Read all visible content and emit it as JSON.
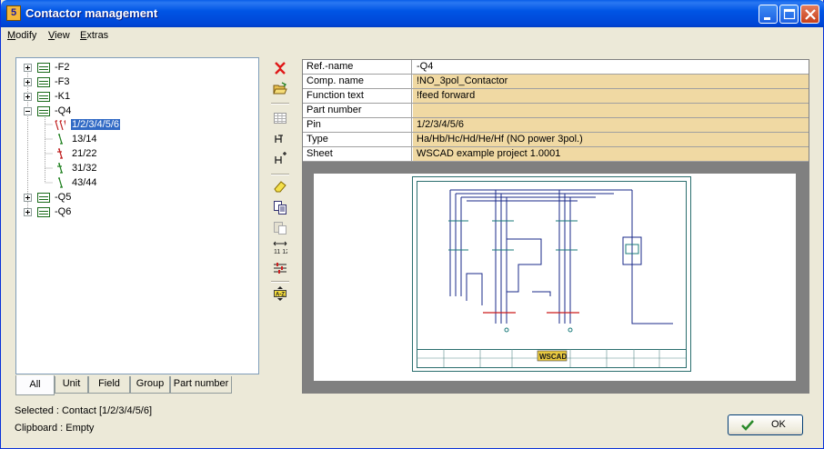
{
  "window": {
    "title": "Contactor management",
    "app_icon_text": "5"
  },
  "menu": [
    {
      "label": "Modify",
      "hotkey_index": 0
    },
    {
      "label": "View",
      "hotkey_index": 0
    },
    {
      "label": "Extras",
      "hotkey_index": 0
    }
  ],
  "tree": {
    "nodes": [
      {
        "label": "-F2",
        "expanded": false
      },
      {
        "label": "-F3",
        "expanded": false
      },
      {
        "label": "-K1",
        "expanded": false
      },
      {
        "label": "-Q4",
        "expanded": true,
        "children": [
          {
            "label": "1/2/3/4/5/6",
            "selected": true
          },
          {
            "label": "13/14"
          },
          {
            "label": "21/22"
          },
          {
            "label": "31/32"
          },
          {
            "label": "43/44"
          }
        ]
      },
      {
        "label": "-Q5",
        "expanded": false
      },
      {
        "label": "-Q6",
        "expanded": false
      }
    ]
  },
  "tabs": [
    "All",
    "Unit",
    "Field",
    "Group",
    "Part number"
  ],
  "active_tab": "All",
  "toolbar_icons": [
    "delete-icon",
    "open-folder-icon",
    "table-icon",
    "contact-icon",
    "contact-plus-icon",
    "eraser-icon",
    "copy-icon",
    "paste-icon",
    "numbering-icon",
    "settings-icon",
    "rename-icon"
  ],
  "properties": [
    {
      "name": "Ref.-name",
      "value": "-Q4"
    },
    {
      "name": "Comp. name",
      "value": "!NO_3pol_Contactor"
    },
    {
      "name": "Function text",
      "value": "!feed forward"
    },
    {
      "name": "Part number",
      "value": ""
    },
    {
      "name": "Pin",
      "value": "1/2/3/4/5/6"
    },
    {
      "name": "Type",
      "value": "Ha/Hb/Hc/Hd/He/Hf (NO power 3pol.)"
    },
    {
      "name": "Sheet",
      "value": "WSCAD example project 1.0001"
    }
  ],
  "preview": {
    "logo_text": "WSCAD"
  },
  "status": {
    "selected": "Selected : Contact [1/2/3/4/5/6]",
    "clipboard": "Clipboard : Empty"
  },
  "ok_button": {
    "label": "OK"
  },
  "colors": {
    "title_bar": "#0055e5",
    "selection": "#316ac5",
    "property_value_bg": "#f0d9a3",
    "schematic": "#0a1f8a"
  }
}
